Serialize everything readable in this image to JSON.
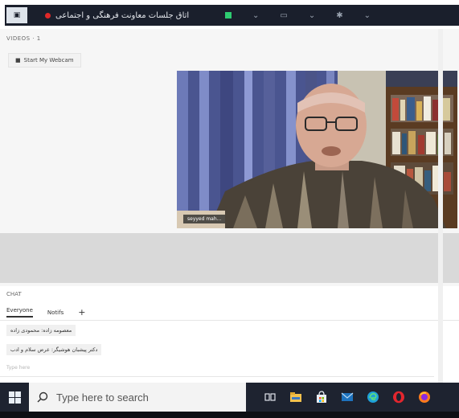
{
  "topbar": {
    "title": "اتاق جلسات معاونت فرهنگی و اجتماعی",
    "logo_glyph": "▣"
  },
  "videos": {
    "header": "VIDEOS · 1",
    "start_webcam": "Start My Webcam",
    "participant_name": "seyyed mah..."
  },
  "chat": {
    "header": "CHAT",
    "tabs": [
      "Everyone",
      "Notifs"
    ],
    "add_tab": "+",
    "messages": [
      "معصومه زاده: محمودی زاده",
      "دکتر پیشبان هوشیگر: عرض سلام و ادب"
    ],
    "input_placeholder": "Type here"
  },
  "taskbar": {
    "search_placeholder": "Type here to search",
    "apps": [
      "task-view",
      "file-explorer",
      "store",
      "mail",
      "edge",
      "opera",
      "firefox"
    ]
  },
  "colors": {
    "titlebar": "#1a1f2c",
    "taskbar": "#1e2330",
    "rec": "#e02828"
  }
}
